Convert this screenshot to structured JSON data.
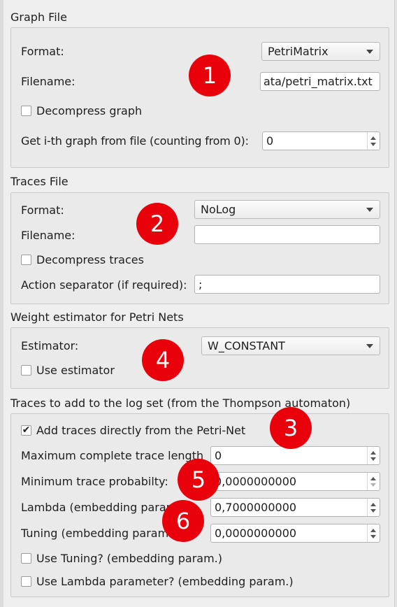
{
  "graph_file": {
    "title": "Graph File",
    "format_label": "Format:",
    "format_value": "PetriMatrix",
    "filename_label": "Filename:",
    "filename_value": "ata/petri_matrix.txt",
    "decompress_label": "Decompress graph",
    "decompress_checked": false,
    "ith_label": "Get i-th graph from file (counting from 0):",
    "ith_value": "0"
  },
  "traces_file": {
    "title": "Traces File",
    "format_label": "Format:",
    "format_value": "NoLog",
    "filename_label": "Filename:",
    "filename_value": "",
    "decompress_label": "Decompress traces",
    "decompress_checked": false,
    "separator_label": "Action separator (if required):",
    "separator_value": ";"
  },
  "weight_estimator": {
    "title": "Weight estimator for Petri Nets",
    "estimator_label": "Estimator:",
    "estimator_value": "W_CONSTANT",
    "use_label": "Use estimator",
    "use_checked": false
  },
  "traces_add": {
    "title": "Traces to add to the log set (from the Thompson automaton)",
    "add_direct_label": "Add traces directly from the Petri-Net",
    "add_direct_checked": true,
    "max_len_label": "Maximum complete trace length",
    "max_len_value": "0",
    "min_prob_label": "Minimum trace probabilty:",
    "min_prob_value": "0,0000000000",
    "lambda_label": "Lambda (embedding param.)",
    "lambda_value": "0,7000000000",
    "tuning_label": "Tuning (embedding param.)",
    "tuning_value": "0,0000000000",
    "use_tuning_label": "Use Tuning? (embedding param.)",
    "use_tuning_checked": false,
    "use_lambda_label": "Use Lambda parameter? (embedding param.)",
    "use_lambda_checked": false
  },
  "badges": [
    "1",
    "2",
    "4",
    "3",
    "5",
    "6"
  ],
  "colors": {
    "badge": "#e8000a",
    "panel": "#efefef"
  }
}
